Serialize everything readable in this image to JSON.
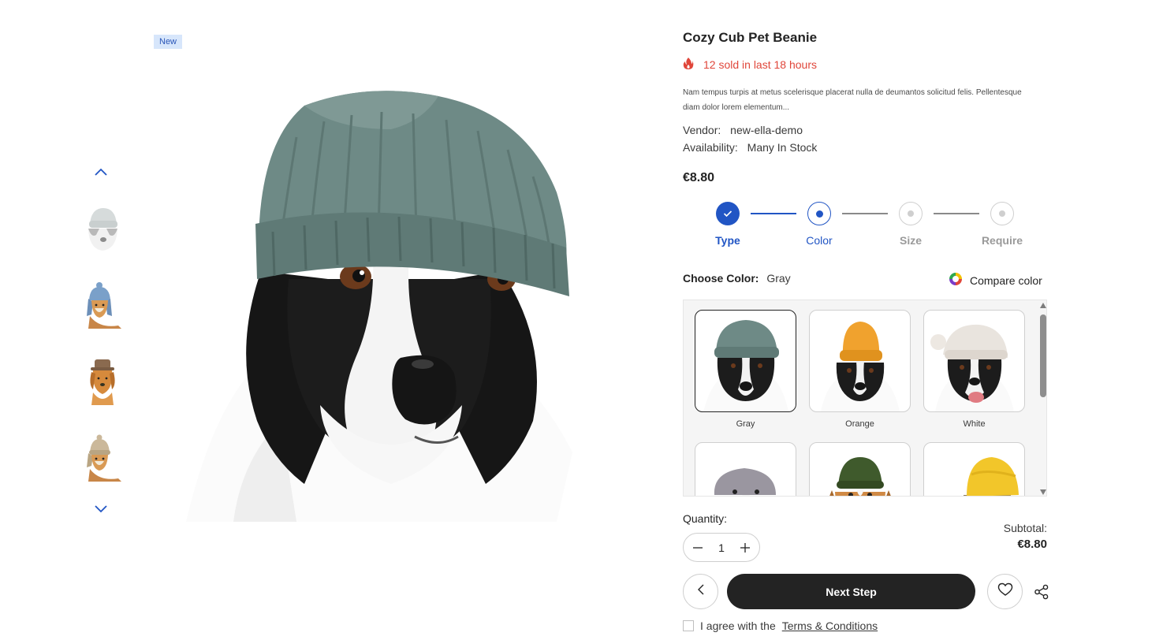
{
  "product": {
    "badge": "New",
    "title": "Cozy Cub Pet Beanie",
    "sold_text": "12 sold in last 18 hours",
    "description": "Nam tempus turpis at metus scelerisque placerat nulla de deumantos solicitud felis. Pellentesque diam dolor lorem elementum...",
    "vendor_label": "Vendor:",
    "vendor_value": "new-ella-demo",
    "availability_label": "Availability:",
    "availability_value": "Many In Stock",
    "price": "€8.80"
  },
  "steps": [
    {
      "label": "Type",
      "state": "done"
    },
    {
      "label": "Color",
      "state": "active"
    },
    {
      "label": "Size",
      "state": "todo"
    },
    {
      "label": "Require",
      "state": "todo"
    }
  ],
  "color_picker": {
    "label": "Choose Color:",
    "selected": "Gray",
    "compare_label": "Compare color",
    "options": [
      {
        "name": "Gray",
        "hat_color": "#6e8a86"
      },
      {
        "name": "Orange",
        "hat_color": "#f0a22e"
      },
      {
        "name": "White",
        "hat_color": "#e9e4de"
      },
      {
        "name": "",
        "hat_color": "#9a96a0"
      },
      {
        "name": "",
        "hat_color": "#3f5a2c"
      },
      {
        "name": "",
        "hat_color": "#f2c62a"
      }
    ]
  },
  "quantity": {
    "label": "Quantity:",
    "value": "1"
  },
  "subtotal": {
    "label": "Subtotal:",
    "value": "€8.80"
  },
  "actions": {
    "next_label": "Next Step"
  },
  "agree": {
    "prefix": "I agree with the",
    "link": "Terms & Conditions"
  },
  "colors": {
    "accent": "#2155c4",
    "sold": "#e0463a",
    "button_dark": "#232323"
  }
}
